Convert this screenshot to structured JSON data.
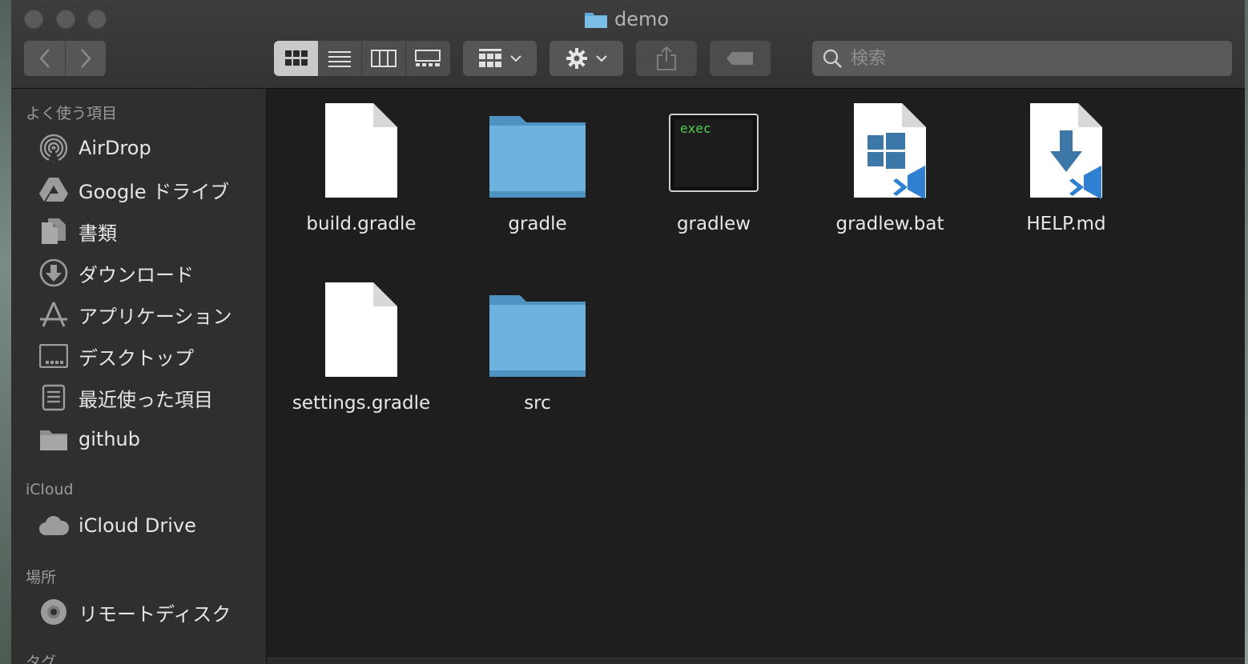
{
  "window": {
    "title": "demo"
  },
  "toolbar": {
    "back_icon": "chevron-left-icon",
    "forward_icon": "chevron-right-icon",
    "views": [
      "icon-view-icon",
      "list-view-icon",
      "column-view-icon",
      "gallery-view-icon"
    ],
    "selected_view": "icon-view-icon",
    "group_icon": "group-icon",
    "action_icon": "gear-icon",
    "share_icon": "share-icon",
    "tag_icon": "tag-icon",
    "search_placeholder": "検索"
  },
  "sidebar": {
    "favorites_label": "よく使う項目",
    "favorites": [
      {
        "label": "AirDrop",
        "icon": "airdrop-icon"
      },
      {
        "label": "Google ドライブ",
        "icon": "google-drive-icon"
      },
      {
        "label": "書類",
        "icon": "documents-icon"
      },
      {
        "label": "ダウンロード",
        "icon": "download-icon"
      },
      {
        "label": "アプリケーション",
        "icon": "applications-icon"
      },
      {
        "label": "デスクトップ",
        "icon": "desktop-icon"
      },
      {
        "label": "最近使った項目",
        "icon": "recents-icon"
      },
      {
        "label": "github",
        "icon": "folder-icon"
      }
    ],
    "icloud_label": "iCloud",
    "icloud": [
      {
        "label": "iCloud Drive",
        "icon": "cloud-icon"
      }
    ],
    "locations_label": "場所",
    "locations": [
      {
        "label": "リモートディスク",
        "icon": "disc-icon"
      }
    ],
    "tags_label": "タグ"
  },
  "files": [
    {
      "name": "build.gradle",
      "kind": "document"
    },
    {
      "name": "gradle",
      "kind": "folder"
    },
    {
      "name": "gradlew",
      "kind": "exec",
      "badge": "exec"
    },
    {
      "name": "gradlew.bat",
      "kind": "windows-doc"
    },
    {
      "name": "HELP.md",
      "kind": "download-doc"
    },
    {
      "name": "settings.gradle",
      "kind": "document"
    },
    {
      "name": "src",
      "kind": "folder"
    }
  ],
  "colors": {
    "folder": "#5fa8d8",
    "exec_text": "#4fd14f",
    "vscode_blue": "#2f7fd3"
  }
}
